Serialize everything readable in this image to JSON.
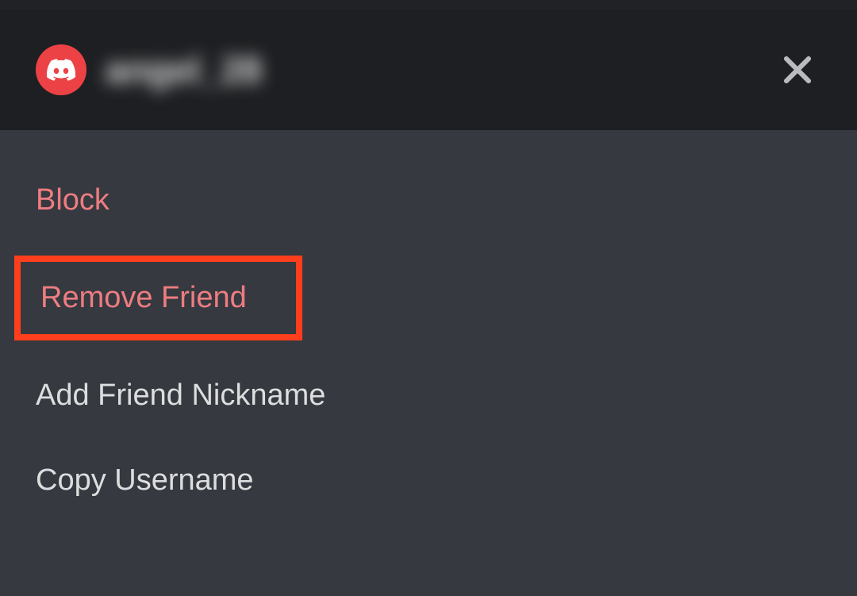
{
  "header": {
    "username": "angel_28"
  },
  "menu": {
    "items": [
      {
        "label": "Block",
        "danger": true,
        "highlighted": false
      },
      {
        "label": "Remove Friend",
        "danger": true,
        "highlighted": true
      },
      {
        "label": "Add Friend Nickname",
        "danger": false,
        "highlighted": false
      },
      {
        "label": "Copy Username",
        "danger": false,
        "highlighted": false
      }
    ]
  },
  "icons": {
    "close": "close-icon",
    "avatar": "discord-icon"
  },
  "colors": {
    "accent": "#ed4245",
    "danger_text": "#ed7d81",
    "highlight_border": "#ff3e1d",
    "header_bg": "#1e1f22",
    "body_bg": "#36393f",
    "text_default": "#dcddde"
  }
}
